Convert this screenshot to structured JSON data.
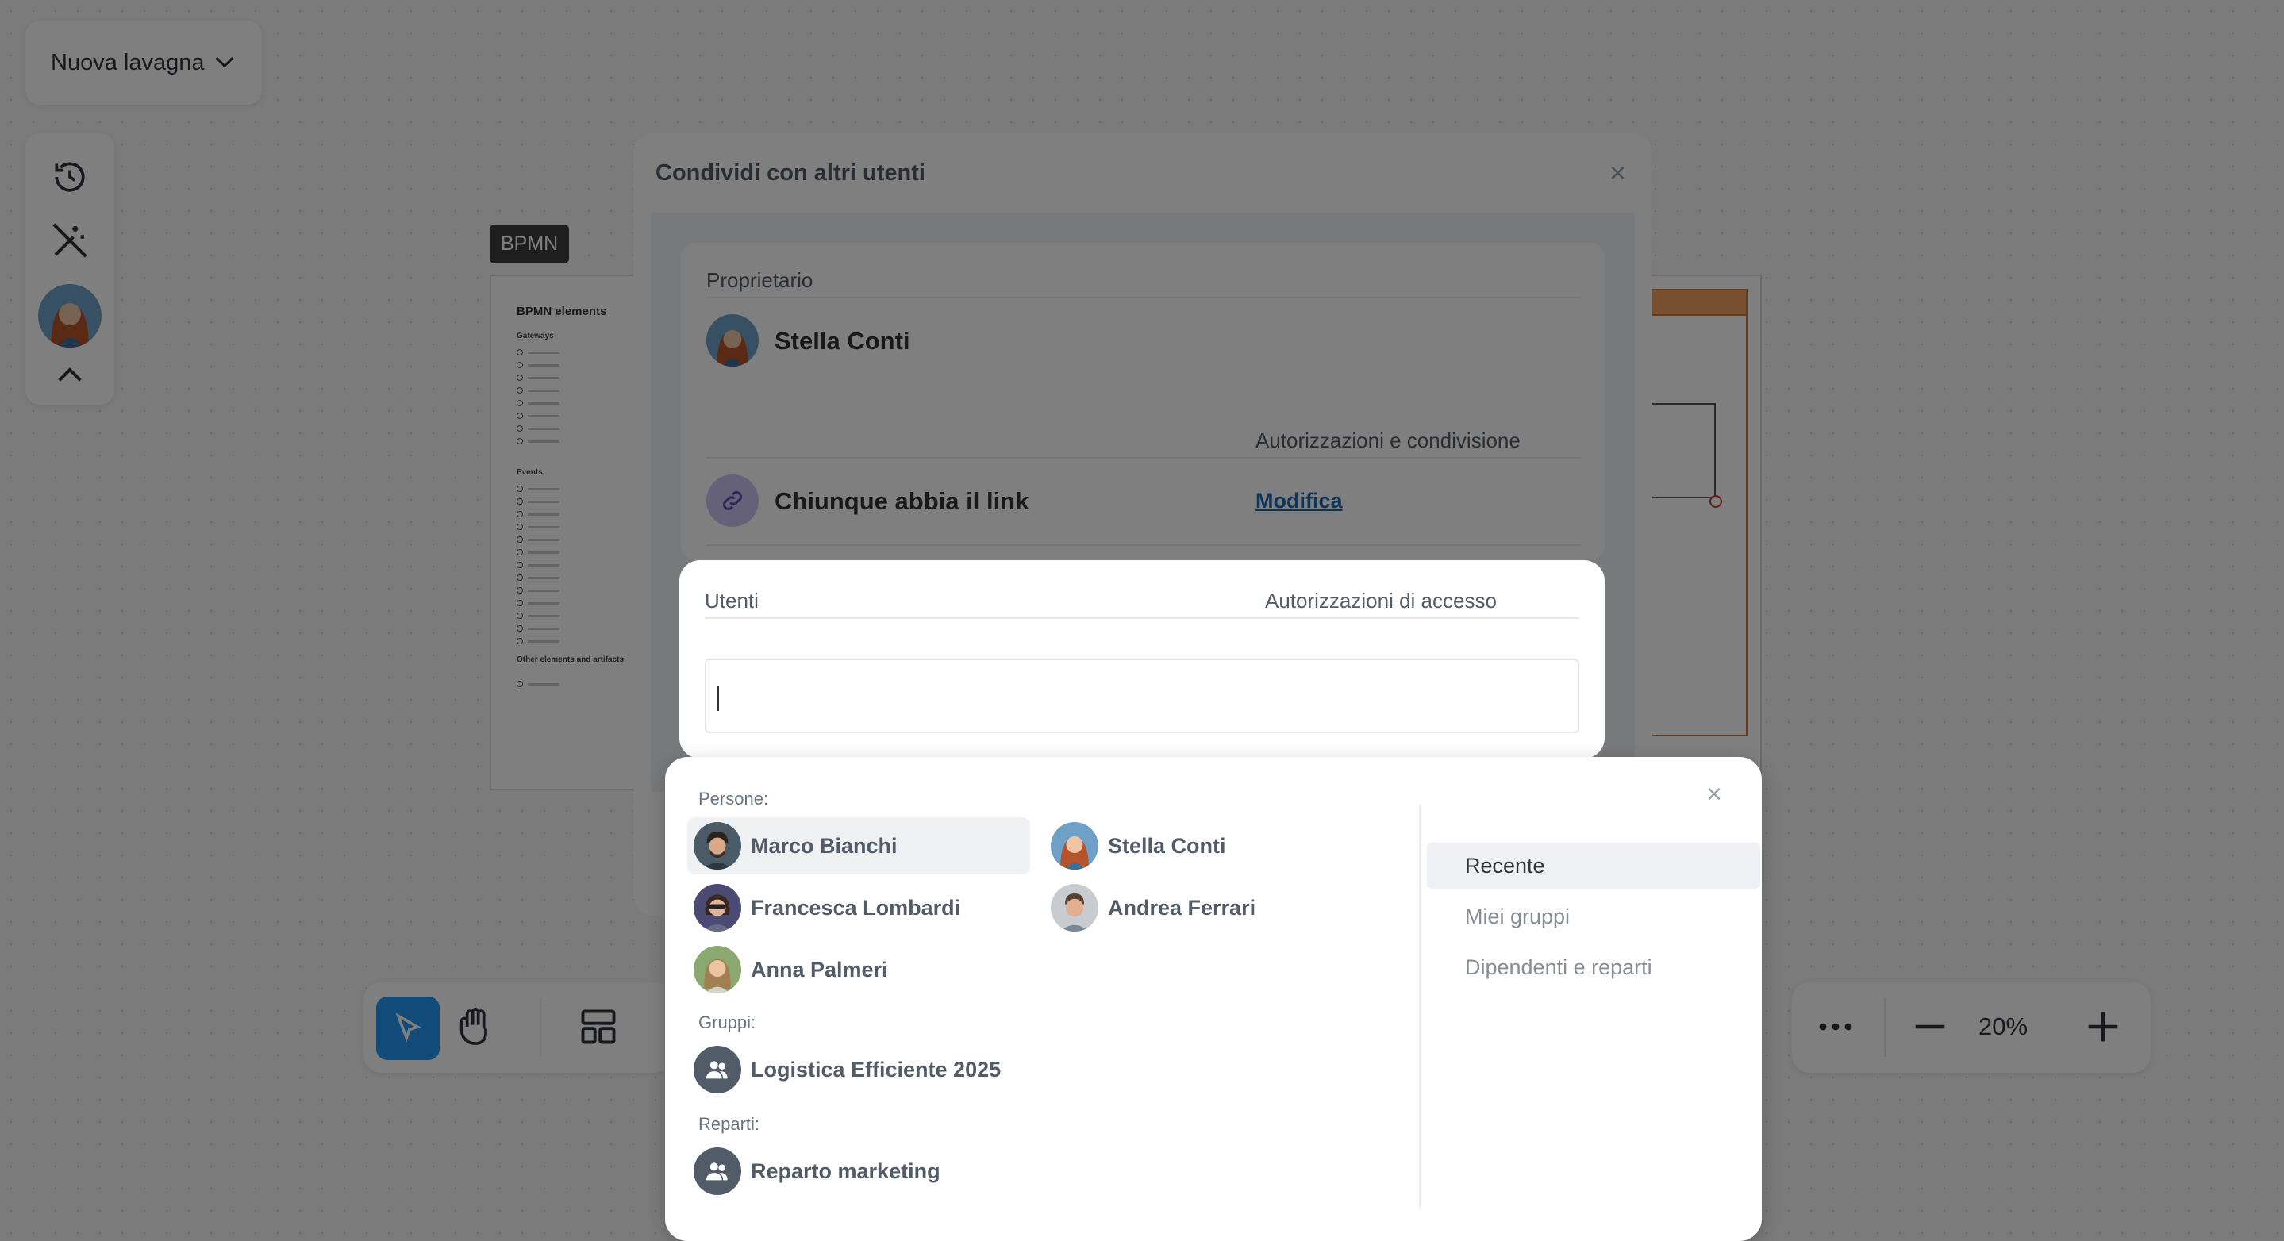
{
  "board": {
    "title": "Nuova lavagna",
    "bpmn_tag": "BPMN",
    "bpmn_heading": "BPMN elements",
    "bpmn_sections": [
      "Gateways",
      "Events",
      "Other elements and artifacts"
    ]
  },
  "zoom": {
    "value": "20%"
  },
  "modal": {
    "title": "Condividi con altri utenti",
    "owner_label": "Proprietario",
    "owner_name": "Stella Conti",
    "permissions_label": "Autorizzazioni e condivisione",
    "link_label": "Chiunque abbia il link",
    "edit_link": "Modifica",
    "users_label": "Utenti",
    "access_label": "Autorizzazioni di accesso"
  },
  "popup": {
    "people_label": "Persone:",
    "people": [
      {
        "name": "Marco Bianchi"
      },
      {
        "name": "Stella Conti"
      },
      {
        "name": "Francesca Lombardi"
      },
      {
        "name": "Andrea Ferrari"
      },
      {
        "name": "Anna Palmeri"
      }
    ],
    "groups_label": "Gruppi:",
    "groups": [
      {
        "name": "Logistica Efficiente 2025"
      }
    ],
    "departments_label": "Reparti:",
    "departments": [
      {
        "name": "Reparto marketing"
      }
    ],
    "tabs": [
      {
        "label": "Recente",
        "active": true
      },
      {
        "label": "Miei gruppi",
        "active": false
      },
      {
        "label": "Dipendenti e reparti",
        "active": false
      }
    ]
  },
  "colors": {
    "accent": "#2196f3",
    "link": "#2067b0",
    "group_avatar": "#525c69",
    "link_icon_bg": "#c9c2f0"
  }
}
